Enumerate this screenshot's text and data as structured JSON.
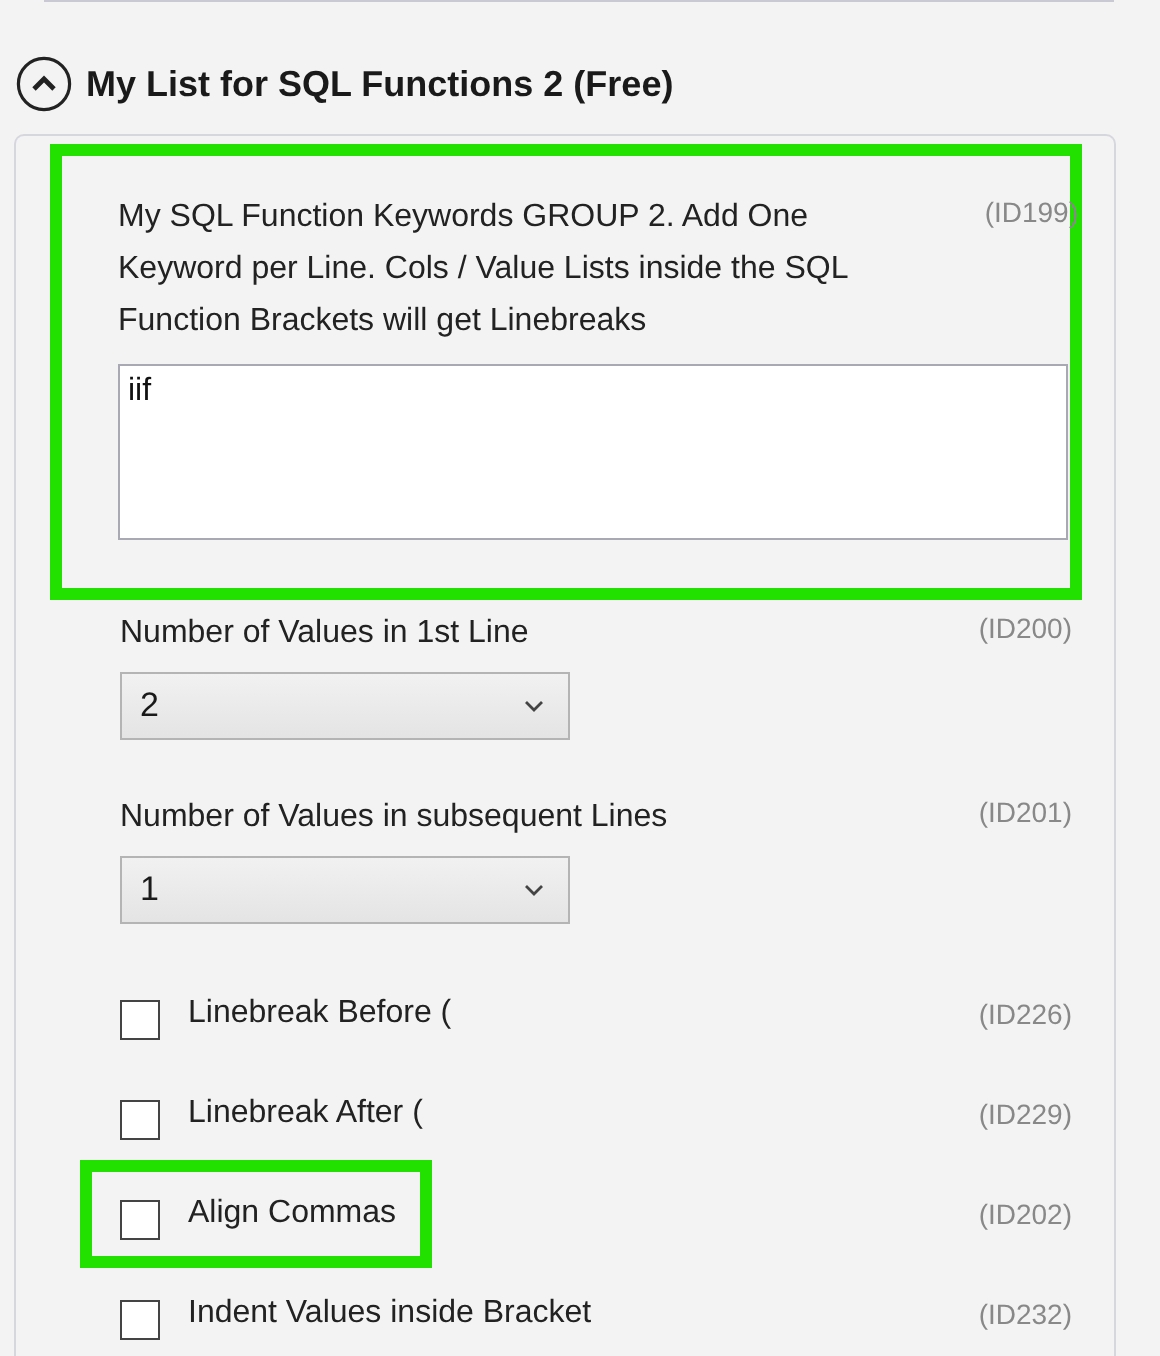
{
  "section": {
    "title": "My List for SQL Functions 2 (Free)",
    "expanded": true
  },
  "settings": [
    {
      "kind": "textarea",
      "label": "My SQL Function Keywords GROUP 2. Add One Keyword per Line. Cols / Value Lists inside the SQL Function Brackets will get Linebreaks",
      "id": "(ID199)",
      "value": "iif",
      "highlighted": true
    },
    {
      "kind": "select",
      "label": "Number of Values in 1st Line",
      "id": "(ID200)",
      "value": "2",
      "highlighted": false
    },
    {
      "kind": "select",
      "label": "Number of Values in subsequent Lines",
      "id": "(ID201)",
      "value": "1",
      "highlighted": false
    },
    {
      "kind": "checkbox",
      "label": "Linebreak Before (",
      "id": "(ID226)",
      "checked": false,
      "highlighted": false
    },
    {
      "kind": "checkbox",
      "label": "Linebreak After (",
      "id": "(ID229)",
      "checked": false,
      "highlighted": false
    },
    {
      "kind": "checkbox",
      "label": "Align Commas",
      "id": "(ID202)",
      "checked": false,
      "highlighted": true
    },
    {
      "kind": "checkbox",
      "label": "Indent Values inside Bracket",
      "id": "(ID232)",
      "checked": false,
      "highlighted": false
    }
  ]
}
